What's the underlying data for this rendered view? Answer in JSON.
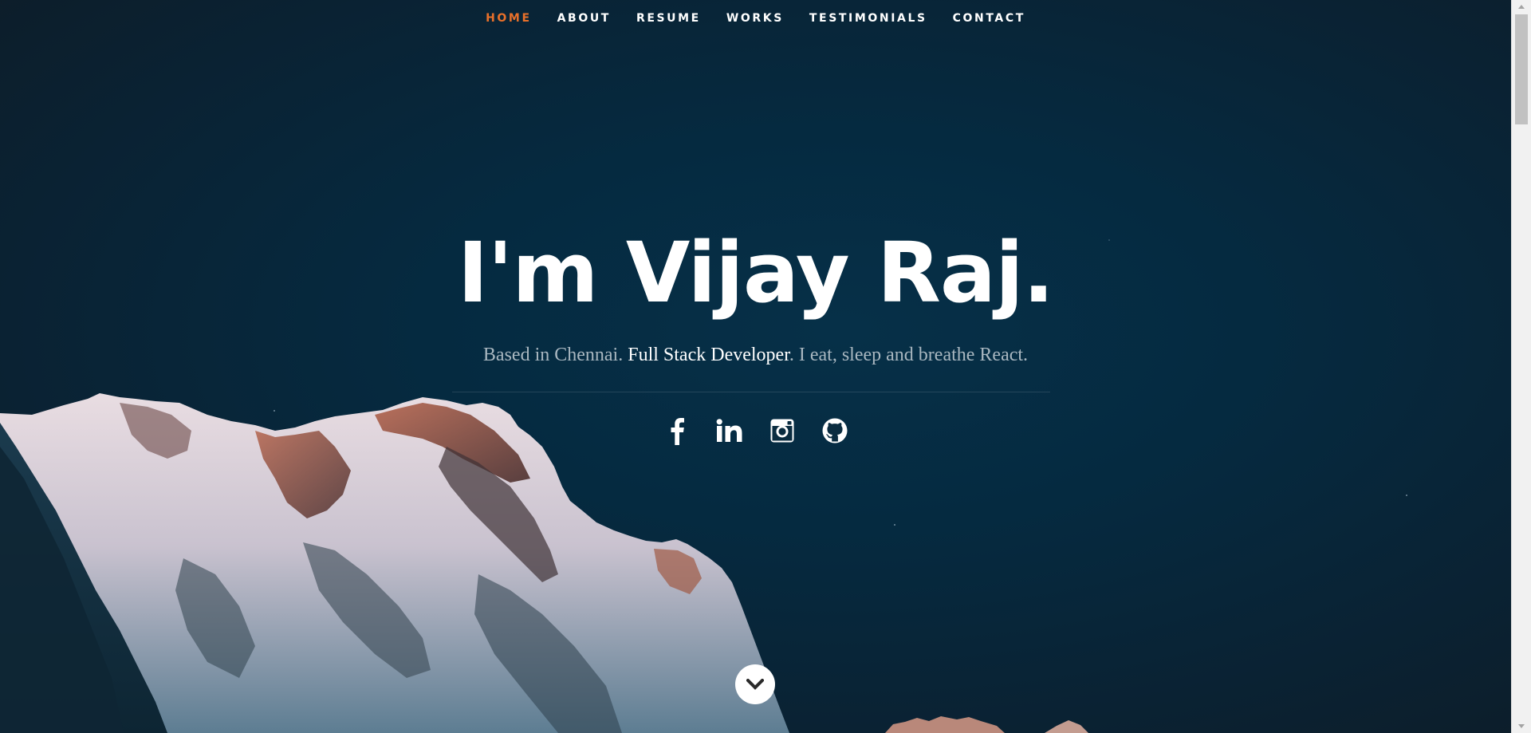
{
  "nav": {
    "items": [
      {
        "label": "HOME",
        "active": true
      },
      {
        "label": "ABOUT",
        "active": false
      },
      {
        "label": "RESUME",
        "active": false
      },
      {
        "label": "WORKS",
        "active": false
      },
      {
        "label": "TESTIMONIALS",
        "active": false
      },
      {
        "label": "CONTACT",
        "active": false
      }
    ]
  },
  "hero": {
    "title": "I'm Vijay Raj.",
    "subtitle_before": "Based in Chennai. ",
    "subtitle_highlight": "Full Stack Developer",
    "subtitle_after": ". I eat, sleep and breathe React."
  },
  "social": {
    "icons": [
      "facebook-icon",
      "linkedin-icon",
      "instagram-icon",
      "github-icon"
    ]
  },
  "scroll_down": {
    "icon": "chevron-down-icon"
  },
  "colors": {
    "accent": "#e8702a",
    "background": "#052a40",
    "text": "#ffffff",
    "subtitle": "#a9b7c0"
  }
}
